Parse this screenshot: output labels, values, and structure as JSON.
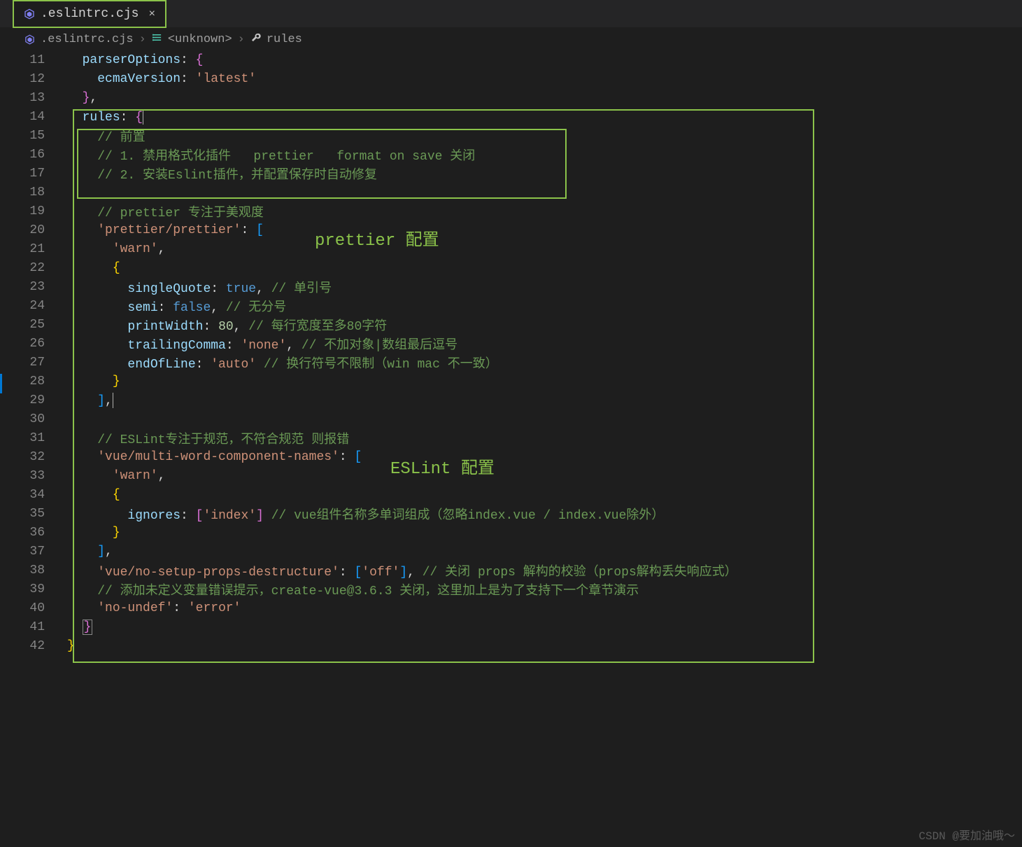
{
  "tab": {
    "filename": ".eslintrc.cjs"
  },
  "breadcrumbs": {
    "file": ".eslintrc.cjs",
    "symbol1": "<unknown>",
    "symbol2": "rules"
  },
  "line_numbers": [
    "11",
    "12",
    "13",
    "14",
    "15",
    "16",
    "17",
    "18",
    "19",
    "20",
    "21",
    "22",
    "23",
    "24",
    "25",
    "26",
    "27",
    "28",
    "29",
    "30",
    "31",
    "32",
    "33",
    "34",
    "35",
    "36",
    "37",
    "38",
    "39",
    "40",
    "41",
    "42"
  ],
  "code": {
    "l11_prop": "parserOptions",
    "l12_prop": "ecmaVersion",
    "l12_val": "'latest'",
    "l14_prop": "rules",
    "l15_comment": "// 前置",
    "l16_comment": "// 1. 禁用格式化插件   prettier   format on save 关闭",
    "l17_comment": "// 2. 安装Eslint插件，并配置保存时自动修复",
    "l19_comment": "// prettier 专注于美观度",
    "l20_key": "'prettier/prettier'",
    "l21_val": "'warn'",
    "l23_prop": "singleQuote",
    "l23_val": "true",
    "l23_comment": "// 单引号",
    "l24_prop": "semi",
    "l24_val": "false",
    "l24_comment": "// 无分号",
    "l25_prop": "printWidth",
    "l25_val": "80",
    "l25_comment": "// 每行宽度至多80字符",
    "l26_prop": "trailingComma",
    "l26_val": "'none'",
    "l26_comment": "// 不加对象|数组最后逗号",
    "l27_prop": "endOfLine",
    "l27_val": "'auto'",
    "l27_comment": "// 换行符号不限制（win mac 不一致）",
    "l31_comment": "// ESLint专注于规范，不符合规范 则报错",
    "l32_key": "'vue/multi-word-component-names'",
    "l33_val": "'warn'",
    "l35_prop": "ignores",
    "l35_val": "'index'",
    "l35_comment": "// vue组件名称多单词组成（忽略index.vue / index.vue除外）",
    "l38_key": "'vue/no-setup-props-destructure'",
    "l38_val": "'off'",
    "l38_comment": "// 关闭 props 解构的校验（props解构丢失响应式）",
    "l39_comment": "// 添加未定义变量错误提示，create-vue@3.6.3 关闭，这里加上是为了支持下一个章节演示",
    "l40_key": "'no-undef'",
    "l40_val": "'error'"
  },
  "annotations": {
    "prettier": "prettier 配置",
    "eslint": "ESLint 配置"
  },
  "watermark": "CSDN @要加油哦～"
}
